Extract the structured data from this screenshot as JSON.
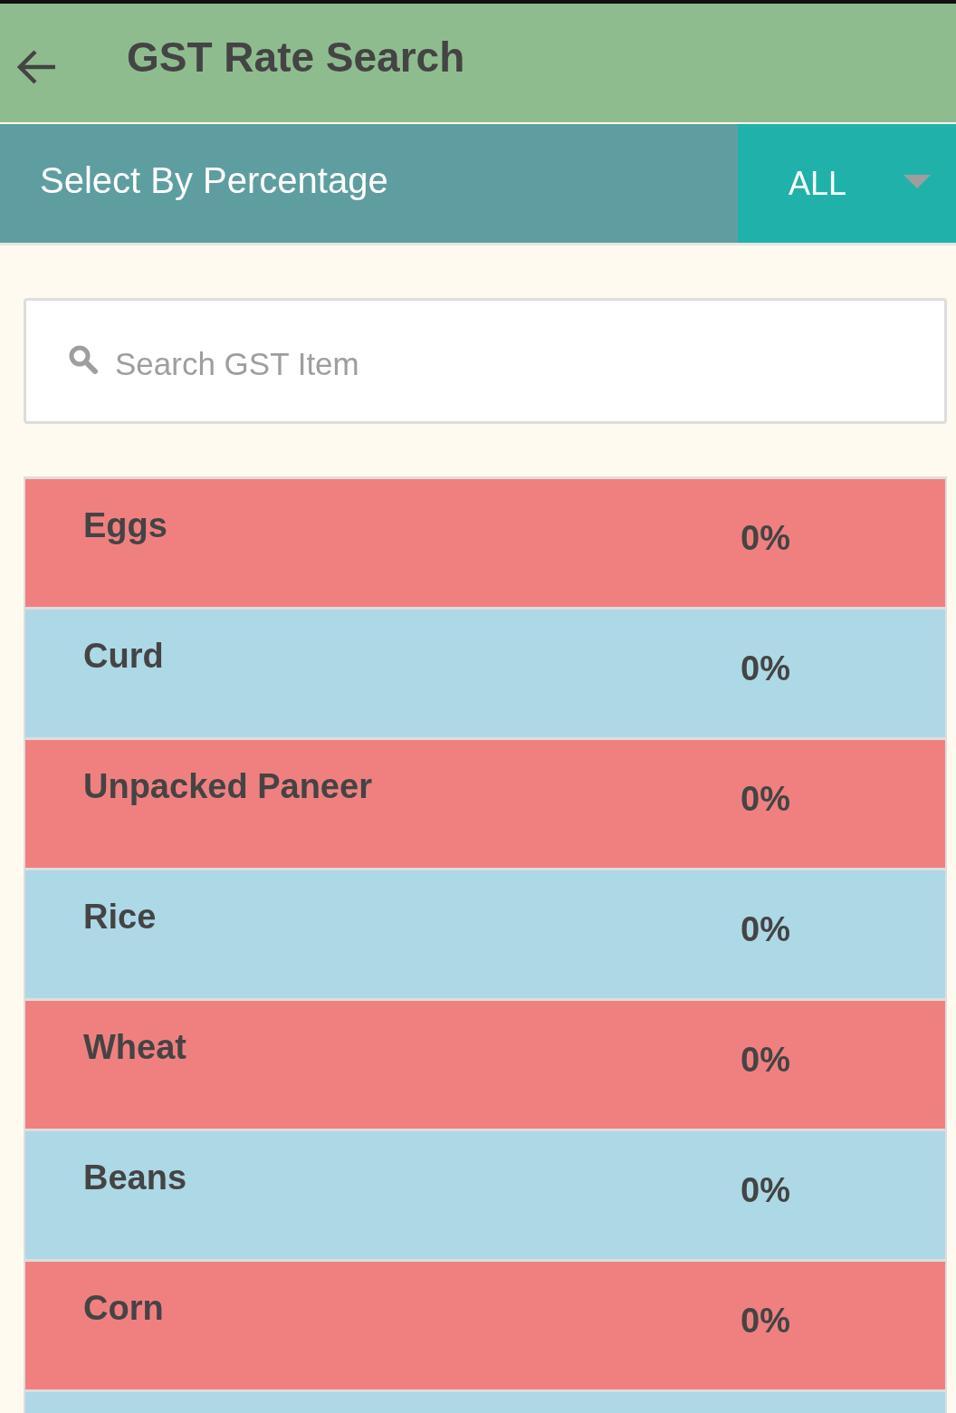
{
  "app_bar": {
    "title": "GST Rate Search"
  },
  "filter": {
    "label": "Select By Percentage",
    "value": "ALL"
  },
  "search": {
    "placeholder": "Search GST Item"
  },
  "items": [
    {
      "name": "Eggs",
      "rate": "0%",
      "color": "#f08080"
    },
    {
      "name": "Curd",
      "rate": "0%",
      "color": "#add8e6"
    },
    {
      "name": "Unpacked Paneer",
      "rate": "0%",
      "color": "#f08080"
    },
    {
      "name": "Rice",
      "rate": "0%",
      "color": "#add8e6"
    },
    {
      "name": "Wheat",
      "rate": "0%",
      "color": "#f08080"
    },
    {
      "name": "Beans",
      "rate": "0%",
      "color": "#add8e6"
    },
    {
      "name": "Corn",
      "rate": "0%",
      "color": "#f08080"
    },
    {
      "color": "#add8e6"
    }
  ]
}
